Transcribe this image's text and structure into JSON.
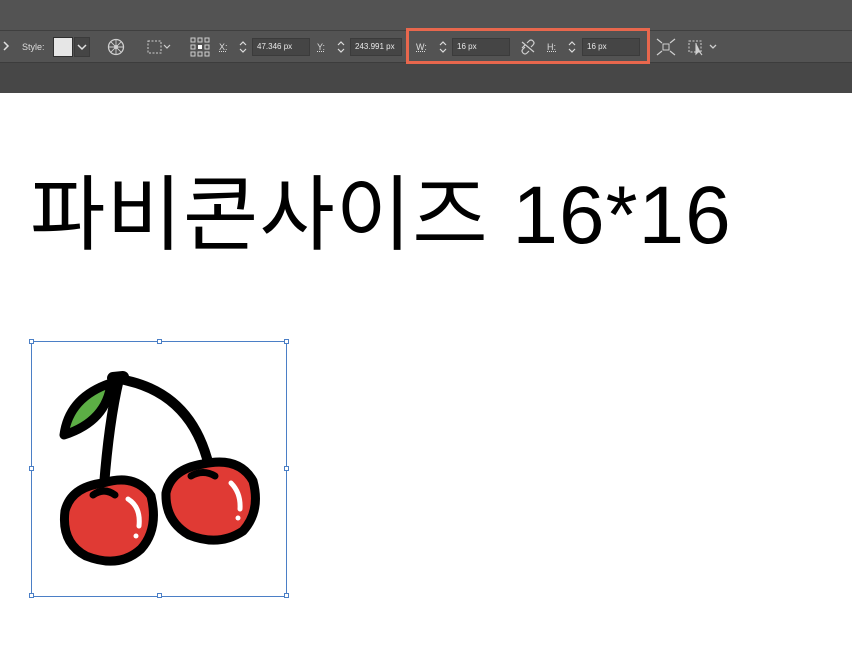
{
  "toolbar": {
    "style_label": "Style:",
    "x_label": "X:",
    "x_value": "47.346 px",
    "y_label": "Y:",
    "y_value": "243.991 px",
    "w_label": "W:",
    "w_value": "16 px",
    "h_label": "H:",
    "h_value": "16 px",
    "swatch_color": "#e6e6e6"
  },
  "highlight_color": "#e8674d",
  "canvas": {
    "heading": "파비콘사이즈 16*16",
    "image": "cherry-icon",
    "selection_color": "#4b7fc6"
  }
}
